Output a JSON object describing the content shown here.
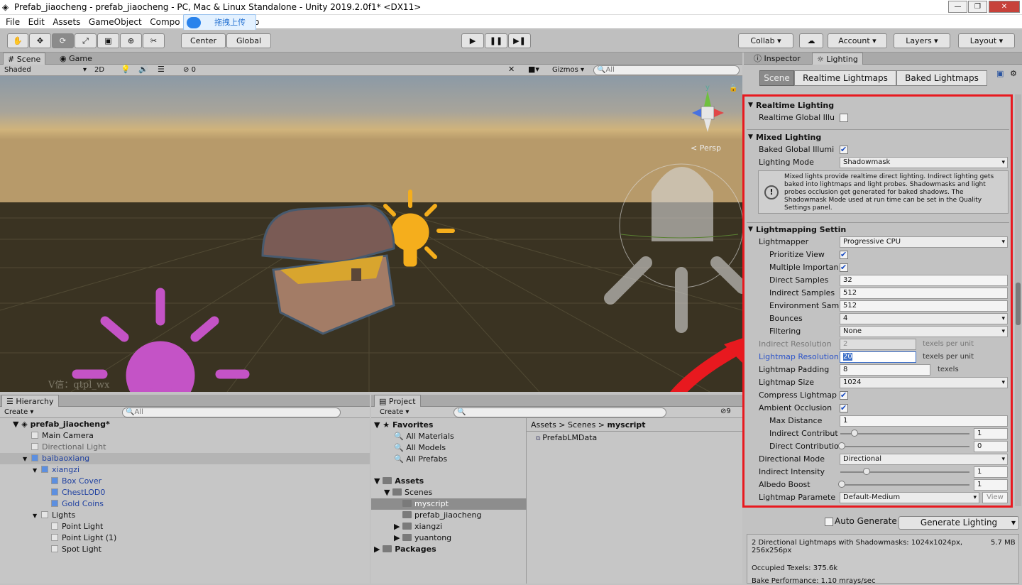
{
  "window": {
    "title": "Prefab_jiaocheng - prefab_jiaocheng - PC, Mac & Linux Standalone - Unity 2019.2.0f1* <DX11>",
    "minimize": "—",
    "maximize": "❐",
    "close": "✕"
  },
  "menu": [
    "File",
    "Edit",
    "Assets",
    "GameObject",
    "Compo",
    "elp"
  ],
  "upload_button": {
    "label": "拖拽上传",
    "icon": "cloud-icon"
  },
  "toolbar": {
    "pivot": "Center",
    "space": "Global",
    "collab": "Collab ▾",
    "account": "Account",
    "layers": "Layers",
    "layout": "Layout"
  },
  "scene_tabs": {
    "scene": "Scene",
    "game": "Game"
  },
  "scene_bar": {
    "shading": "Shaded",
    "mode_2d": "2D",
    "hidden_count": "0",
    "gizmos": "Gizmos",
    "search_placeholder": "All"
  },
  "scene_view": {
    "persp": "Persp",
    "watermark": "V信：qtpl_wx"
  },
  "hierarchy": {
    "tab": "Hierarchy",
    "create": "Create",
    "search_placeholder": "All",
    "scene": "prefab_jiaocheng*",
    "items": [
      {
        "label": "Main Camera",
        "indent": 1,
        "blue": false,
        "toggle": ""
      },
      {
        "label": "Directional Light",
        "indent": 1,
        "blue": false,
        "dim": true,
        "toggle": ""
      },
      {
        "label": "baibaoxiang",
        "indent": 1,
        "blue": true,
        "toggle": "▼"
      },
      {
        "label": "xiangzi",
        "indent": 2,
        "blue": true,
        "toggle": "▼"
      },
      {
        "label": "Box Cover",
        "indent": 3,
        "blue": true,
        "toggle": ""
      },
      {
        "label": "ChestLOD0",
        "indent": 3,
        "blue": true,
        "toggle": ""
      },
      {
        "label": "Gold Coins",
        "indent": 3,
        "blue": true,
        "toggle": ""
      },
      {
        "label": "Lights",
        "indent": 2,
        "blue": false,
        "toggle": "▼"
      },
      {
        "label": "Point Light",
        "indent": 3,
        "blue": false,
        "toggle": ""
      },
      {
        "label": "Point Light (1)",
        "indent": 3,
        "blue": false,
        "toggle": ""
      },
      {
        "label": "Spot Light",
        "indent": 3,
        "blue": false,
        "toggle": ""
      }
    ]
  },
  "project": {
    "tab": "Project",
    "create": "Create",
    "hidden_count": "9",
    "favorites": {
      "label": "Favorites",
      "items": [
        "All Materials",
        "All Models",
        "All Prefabs"
      ]
    },
    "assets": {
      "label": "Assets",
      "scenes": "Scenes",
      "scene_items": [
        "myscript",
        "prefab_jiaocheng"
      ],
      "folders": [
        "xiangzi",
        "yuantong"
      ]
    },
    "packages": "Packages",
    "breadcrumb": [
      "Assets",
      "Scenes",
      "myscript"
    ],
    "files": [
      "PrefabLMData"
    ]
  },
  "inspector_tabs": {
    "inspector": "Inspector",
    "lighting": "Lighting"
  },
  "lighting": {
    "tabs": [
      "Scene",
      "Realtime Lightmaps",
      "Baked Lightmaps"
    ],
    "realtime": {
      "header": "Realtime Lighting",
      "gi_label": "Realtime Global Illu"
    },
    "mixed": {
      "header": "Mixed Lighting",
      "baked_gi": "Baked Global Illumi",
      "mode_label": "Lighting Mode",
      "mode_value": "Shadowmask",
      "info": "Mixed lights provide realtime direct lighting. Indirect lighting gets baked into lightmaps and light probes. Shadowmasks and light probes occlusion get generated for baked shadows. The Shadowmask Mode used at run time can be set in the Quality Settings panel."
    },
    "lightmapping": {
      "header": "Lightmapping Settin",
      "lightmapper": "Lightmapper",
      "lightmapper_value": "Progressive CPU",
      "prioritize": "Prioritize View",
      "multiple": "Multiple Importan",
      "direct_samples": "Direct Samples",
      "direct_samples_value": "32",
      "indirect_samples": "Indirect Samples",
      "indirect_samples_value": "512",
      "env_samples": "Environment Sam",
      "env_samples_value": "512",
      "bounces": "Bounces",
      "bounces_value": "4",
      "filtering": "Filtering",
      "filtering_value": "None",
      "indirect_res": "Indirect Resolution",
      "indirect_res_value": "2",
      "texels_per_unit": "texels per unit",
      "lightmap_res": "Lightmap Resolution",
      "lightmap_res_value": "20",
      "padding": "Lightmap Padding",
      "padding_value": "8",
      "texels": "texels",
      "size": "Lightmap Size",
      "size_value": "1024",
      "compress": "Compress Lightmap",
      "ao": "Ambient Occlusion",
      "max_distance": "Max Distance",
      "max_distance_value": "1",
      "indirect_contrib": "Indirect Contribut",
      "indirect_contrib_value": "1",
      "direct_contrib": "Direct Contributio",
      "direct_contrib_value": "0",
      "dir_mode": "Directional Mode",
      "dir_mode_value": "Directional",
      "indirect_intensity": "Indirect Intensity",
      "indirect_intensity_value": "1",
      "albedo": "Albedo Boost",
      "albedo_value": "1",
      "params": "Lightmap Paramete",
      "params_value": "Default-Medium",
      "view": "View"
    },
    "auto_generate": "Auto Generate",
    "generate": "Generate Lighting",
    "stats": {
      "lightmaps": "2 Directional Lightmaps with Shadowmasks: 1024x1024px, 256x256px",
      "size": "5.7 MB",
      "occupied": "Occupied Texels: 375.6k",
      "bake_perf": "Bake Performance: 1.10 mrays/sec"
    }
  },
  "colors": {
    "highlight_red": "#e8191f",
    "selection_blue": "#3d6fc8",
    "bulb_magenta": "#c453c6",
    "bulb_yellow": "#f5ae1c"
  }
}
